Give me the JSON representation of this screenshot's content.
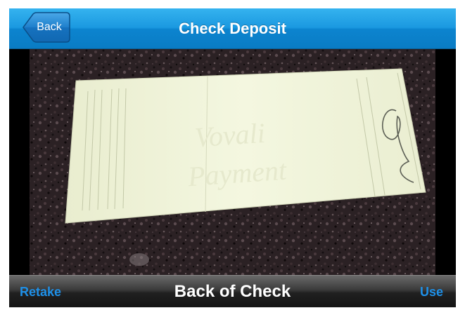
{
  "header": {
    "back_label": "Back",
    "title": "Check Deposit"
  },
  "preview": {
    "subject": "back-of-check-photo"
  },
  "toolbar": {
    "retake_label": "Retake",
    "title": "Back of Check",
    "use_label": "Use"
  },
  "colors": {
    "nav_blue": "#1a98e0",
    "action_blue": "#1e90e8",
    "toolbar_dark": "#202020",
    "check_paper": "#f3f5dc"
  }
}
